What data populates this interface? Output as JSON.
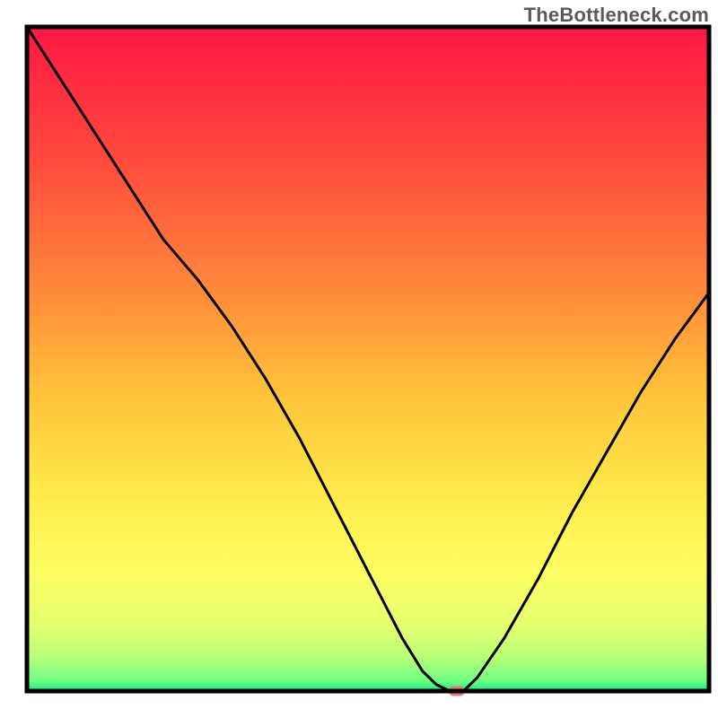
{
  "watermark": "TheBottleneck.com",
  "chart_data": {
    "type": "line",
    "title": "",
    "xlabel": "",
    "ylabel": "",
    "xlim": [
      0,
      100
    ],
    "ylim": [
      0,
      100
    ],
    "x": [
      0,
      5,
      10,
      15,
      20,
      25,
      30,
      35,
      40,
      45,
      50,
      55,
      58,
      60,
      62,
      64,
      66,
      70,
      75,
      80,
      85,
      90,
      95,
      100
    ],
    "values": [
      100,
      92,
      84,
      76,
      68,
      62,
      55,
      47,
      38,
      28,
      18,
      8,
      3,
      1,
      0,
      0,
      2,
      8,
      17,
      27,
      36,
      45,
      53,
      60
    ],
    "marker": {
      "x": 63,
      "y": 0,
      "color": "#e87a76"
    },
    "gradient_stops": [
      {
        "offset": 0.0,
        "color": "#ff1744"
      },
      {
        "offset": 0.2,
        "color": "#ff4a3d"
      },
      {
        "offset": 0.4,
        "color": "#ff8a3a"
      },
      {
        "offset": 0.55,
        "color": "#ffc23a"
      },
      {
        "offset": 0.7,
        "color": "#ffe94a"
      },
      {
        "offset": 0.82,
        "color": "#fdff62"
      },
      {
        "offset": 0.9,
        "color": "#e6ff70"
      },
      {
        "offset": 0.95,
        "color": "#b7ff78"
      },
      {
        "offset": 0.985,
        "color": "#6dff84"
      },
      {
        "offset": 1.0,
        "color": "#17e884"
      }
    ],
    "frame_color": "#000000",
    "line_color": "#000000",
    "line_width": 3
  }
}
